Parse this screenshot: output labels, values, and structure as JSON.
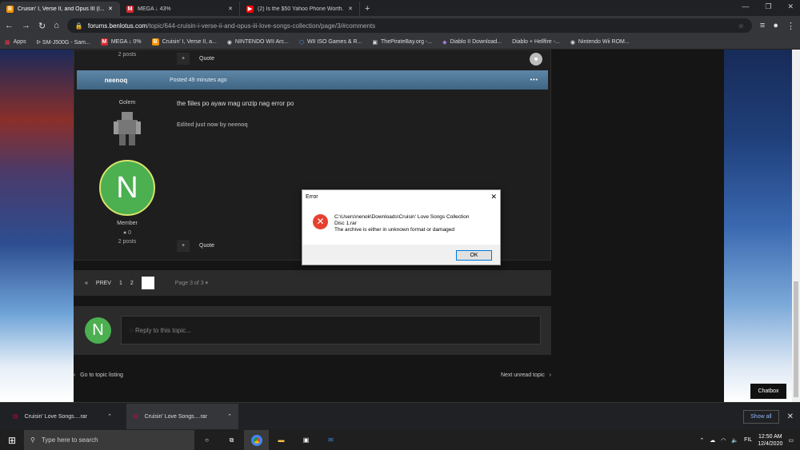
{
  "browser": {
    "tabs": [
      {
        "title": "Cruisin' I, Verse II, and Opus III (I...",
        "fav": "B",
        "fav_color": "#f29200"
      },
      {
        "title": "MEGA ↓ 43%",
        "fav": "M",
        "fav_color": "#d9272e"
      },
      {
        "title": "(2) Is the $50 Yahoo Phone Worth...",
        "fav": "▶",
        "fav_color": "#ff0000"
      }
    ],
    "url_host": "forums.benlotus.com",
    "url_path": "/topic/644-cruisin-i-verse-ii-and-opus-iii-love-songs-collection/page/3/#comments",
    "bookmarks": [
      "Apps",
      "ᐅ SM-J500G - Sam...",
      "MEGA ↓ 0%",
      "Cruisin' I, Verse II, a...",
      "NINTENDO WII Arc...",
      "WII ISO Games & R...",
      "ThePirateBay.org -...",
      "Diablo II Download...",
      "Diablo + Hellfire -...",
      "Nintendo Wii ROM..."
    ]
  },
  "post": {
    "prev_posts": "2 posts",
    "quote": "Quote",
    "plus": "+",
    "author": "neenoq",
    "posted": "Posted 49 minutes ago",
    "more": "•••",
    "rank_title": "Golem",
    "body": "the fiiles po ayaw mag unzip nag error po",
    "edited": "Edited just now by neenoq",
    "avatar_letter": "N",
    "group": "Member",
    "rep": "0",
    "posts": "2 posts"
  },
  "pagination": {
    "prev": "PREV",
    "pages": [
      "1",
      "2"
    ],
    "page_of": "Page 3 of 3"
  },
  "reply": {
    "avatar_letter": "N",
    "placeholder": "Reply to this topic..."
  },
  "nav": {
    "back": "Go to topic listing",
    "next": "Next unread topic"
  },
  "chatbox": "Chatbox",
  "dialog": {
    "title": "Error",
    "line1": "C:\\Users\\nenok\\Downloads\\Cruisin' Love Songs Collection",
    "line2": "Disc 1.rar",
    "line3": "The archive is either in unknown format or damaged",
    "ok": "OK"
  },
  "downloads": {
    "items": [
      "Cruisin' Love Songs....rar",
      "Cruisin' Love Songs....rar"
    ],
    "show_all": "Show all"
  },
  "taskbar": {
    "search": "Type here to search",
    "lang": "FIL",
    "time": "12:50 AM",
    "date": "12/4/2020"
  }
}
